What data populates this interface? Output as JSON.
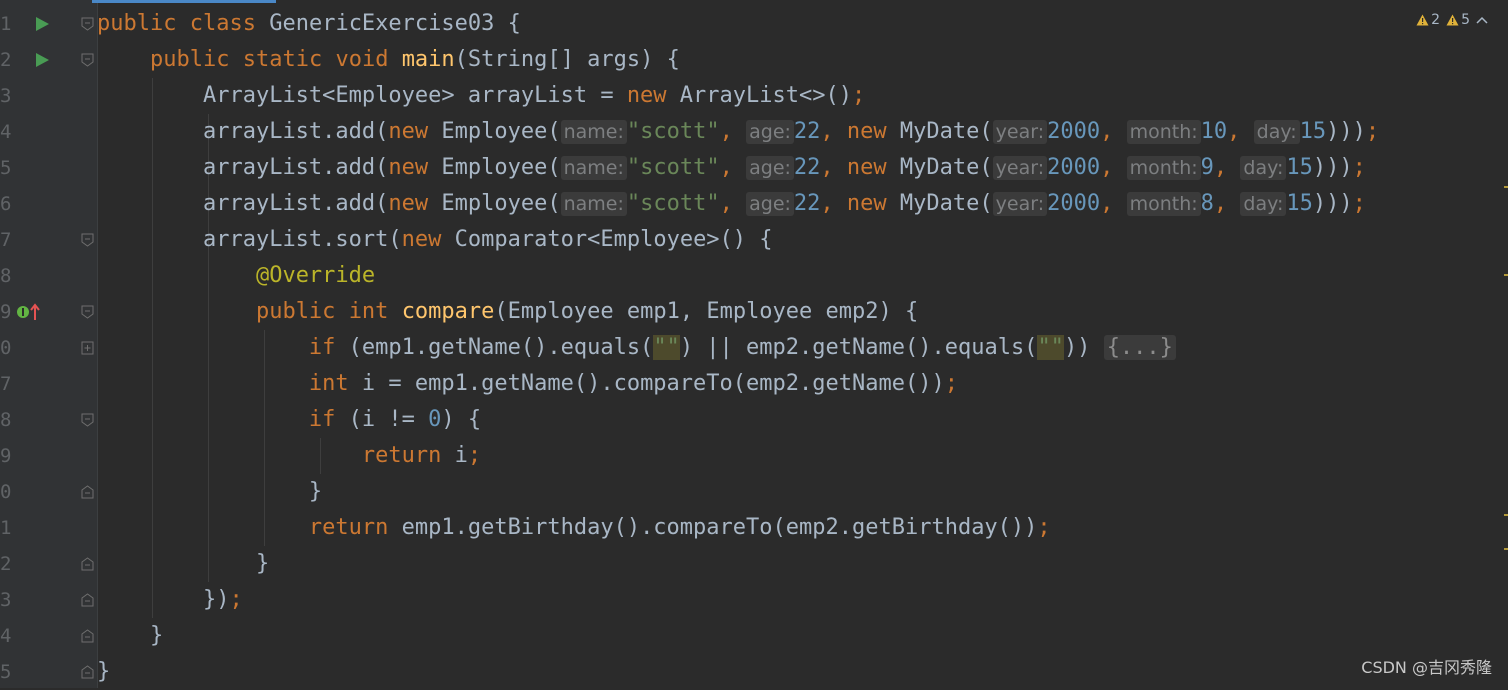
{
  "gutter": {
    "line_numbers": [
      "1",
      "2",
      "3",
      "4",
      "5",
      "6",
      "7",
      "8",
      "9",
      "0",
      "7",
      "8",
      "9",
      "0",
      "1",
      "2",
      "3",
      "4",
      "5"
    ]
  },
  "inspections": {
    "weak_warnings": "2",
    "warnings": "5",
    "warning_color": "#e0b23a",
    "collapse_icon": "chevron-up-icon"
  },
  "code": {
    "l1": {
      "kw1": "public",
      "kw2": "class",
      "name": "GenericExercise03",
      "brace": "{"
    },
    "l2": {
      "kw1": "public",
      "kw2": "static",
      "kw3": "void",
      "fn": "main",
      "params": "(String[] args) {"
    },
    "l3": {
      "p1": "ArrayList<Employee> arrayList = ",
      "kw": "new",
      "p2": " ArrayList<>()",
      "semi": ";"
    },
    "add_rows": [
      {
        "pre": "arrayList.add(",
        "kw1": "new",
        "emp": " Employee(",
        "h_name": "name:",
        "s": "\"scott\"",
        "c1": ",",
        "h_age": "age:",
        "age": "22",
        "c2": ",",
        "kw2": "new",
        "date": " MyDate(",
        "h_year": "year:",
        "year": "2000",
        "c3": ",",
        "h_month": "month:",
        "month": "10",
        "c4": ",",
        "h_day": "day:",
        "day": "15",
        "end": ")))",
        "semi": ";"
      },
      {
        "pre": "arrayList.add(",
        "kw1": "new",
        "emp": " Employee(",
        "h_name": "name:",
        "s": "\"scott\"",
        "c1": ",",
        "h_age": "age:",
        "age": "22",
        "c2": ",",
        "kw2": "new",
        "date": " MyDate(",
        "h_year": "year:",
        "year": "2000",
        "c3": ",",
        "h_month": "month:",
        "month": "9",
        "c4": ",",
        "h_day": "day:",
        "day": "15",
        "end": ")))",
        "semi": ";"
      },
      {
        "pre": "arrayList.add(",
        "kw1": "new",
        "emp": " Employee(",
        "h_name": "name:",
        "s": "\"scott\"",
        "c1": ",",
        "h_age": "age:",
        "age": "22",
        "c2": ",",
        "kw2": "new",
        "date": " MyDate(",
        "h_year": "year:",
        "year": "2000",
        "c3": ",",
        "h_month": "month:",
        "month": "8",
        "c4": ",",
        "h_day": "day:",
        "day": "15",
        "end": ")))",
        "semi": ";"
      }
    ],
    "l7": {
      "pre": "arrayList.sort(",
      "kw": "new",
      "post": " Comparator<Employee>() {"
    },
    "l8": {
      "ann": "@Override"
    },
    "l9": {
      "kw1": "public",
      "kw2": "int",
      "fn": "compare",
      "params": "(Employee emp1, Employee emp2) {"
    },
    "l10": {
      "kw": "if",
      "p1": " (emp1.getName().equals(",
      "s1": "\"\"",
      "p2": ") || emp2.getName().equals(",
      "s2": "\"\"",
      "p3": ")) ",
      "folded": "{...}"
    },
    "l11": {
      "kw": "int",
      "p1": " i = emp1.getName().compareTo(emp2.getName())",
      "semi": ";"
    },
    "l12": {
      "kw": "if",
      "p1": " (i != ",
      "num": "0",
      "p2": ") {"
    },
    "l13": {
      "kw": "return",
      "p1": " i",
      "semi": ";"
    },
    "l14": {
      "p1": "}"
    },
    "l15": {
      "kw": "return",
      "p1": " emp1.getBirthday().compareTo(emp2.getBirthday())",
      "semi": ";"
    },
    "l16": {
      "p1": "}"
    },
    "l17": {
      "p1": "})",
      "semi": ";"
    },
    "l18": {
      "p1": "}"
    },
    "l19": {
      "p1": "}"
    }
  },
  "watermark": "CSDN @吉冈秀隆"
}
